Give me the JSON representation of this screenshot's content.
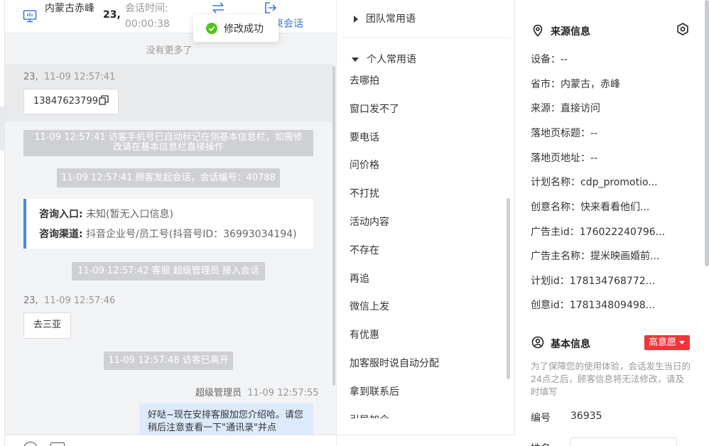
{
  "chat": {
    "header": {
      "visitor_name": "内蒙古赤峰",
      "visitor_id": "23,",
      "session_label": "会话时间:",
      "session_time": "00:00:38",
      "end_label": "束会话"
    },
    "toast": {
      "text": "修改成功"
    },
    "no_more": "没有更多了",
    "messages": {
      "m1_sender": "23,",
      "m1_time": "11-09 12:57:41",
      "m1_text": "13847623799",
      "sys1": "11-09 12:57:41 访客手机号已自动标记在侧基本信息栏，如需修改请在基本信息栏直接操作",
      "sys2": "11-09 12:57:41 顾客发起会话，会话编号：40788",
      "card_entry_label": "咨询入口:",
      "card_entry_value": "未知(暂无入口信息)",
      "card_channel_label": "咨询渠道:",
      "card_channel_value": "抖音企业号/员工号(抖音号ID：36993034194)",
      "sys3": "11-09 12:57:42 客服 超级管理员 接入会话",
      "m2_sender": "23,",
      "m2_time": "11-09 12:57:46",
      "m2_text": "去三亚",
      "sys4": "11-09 12:57:48 访客已离开",
      "m3_sender": "超级管理员",
      "m3_time": "11-09 12:57:55",
      "m3_text": "好哒~现在安排客服加您介绍哈。请您稍后注意查看一下\"通讯录\"并点"
    }
  },
  "phrases": {
    "team_group": "团队常用语",
    "personal_group": "个人常用语",
    "items": [
      "去哪拍",
      "窗口发不了",
      "要电话",
      "问价格",
      "不打扰",
      "活动内容",
      "不存在",
      "再追",
      "微信上发",
      "有优惠",
      "加客服时说自动分配",
      "拿到联系后",
      "引导加企"
    ]
  },
  "info": {
    "source_title": "来源信息",
    "source_fields": [
      "设备：--",
      "省市：内蒙古，赤峰",
      "来源：直接访问",
      "落地页标题：--",
      "落地页地址：--",
      "计划名称：cdp_promotio...",
      "创意名称：快来看看他们...",
      "广告主id：176022240796...",
      "广告主名称：提米映画婚前...",
      "计划id：178134768772...",
      "创意id：178134809498..."
    ],
    "basic_title": "基本信息",
    "intent_badge": "高意愿",
    "notice": "为了保障您的使用体验，会话发生当日的24点之后，顾客信息将无法修改，请及时填写",
    "id_label": "编号",
    "id_value": "36935",
    "next_label": "姓名"
  },
  "colors": {
    "accent": "#3b7ad8",
    "badge": "#f0363b",
    "card_border": "#4a89dc",
    "success": "#52c41a"
  }
}
